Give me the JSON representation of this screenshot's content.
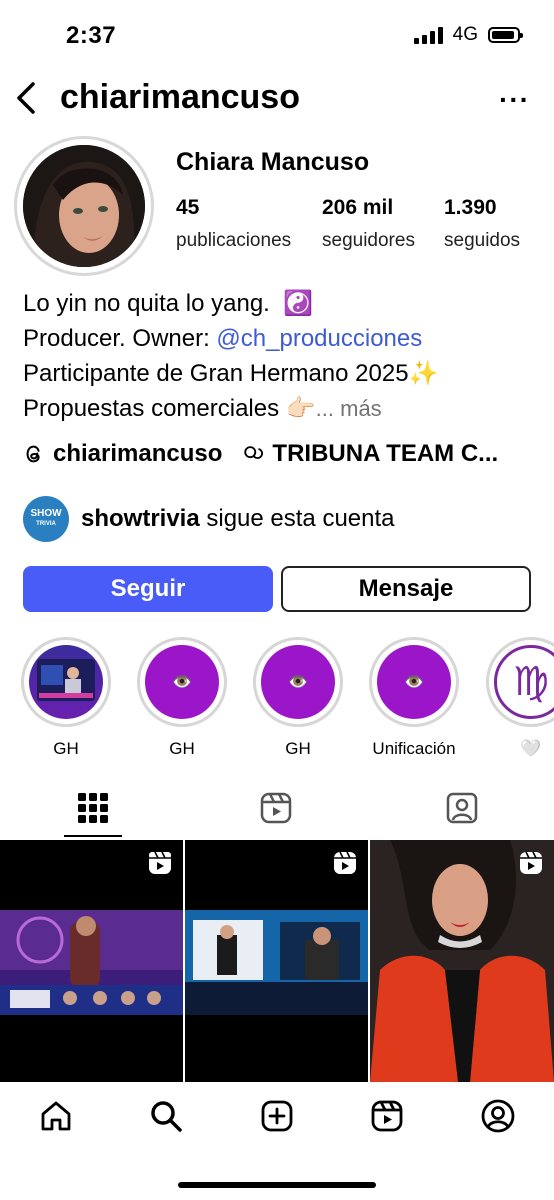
{
  "status_bar": {
    "time": "2:37",
    "network": "4G"
  },
  "header": {
    "username": "chiarimancuso",
    "more": "···"
  },
  "profile": {
    "display_name": "Chiara Mancuso",
    "stats": [
      {
        "value": "45",
        "label": "publicaciones"
      },
      {
        "value": "206 mil",
        "label": "seguidores"
      },
      {
        "value": "1.390",
        "label": "seguidos"
      }
    ],
    "bio": {
      "line1": "Lo yin no quita lo yang.",
      "line1_emoji": "☯️",
      "line2_prefix": "Producer. Owner: ",
      "line2_link": "@ch_producciones",
      "line3": "Participante de Gran Hermano 2025✨",
      "line4": "Propuestas comerciales 👉🏻",
      "line4_more": "... más"
    },
    "threads_handle": "chiarimancuso",
    "community": "TRIBUNA TEAM C..."
  },
  "followed_by": {
    "logo_text_top": "SHOW",
    "logo_text_bottom": "TRIVIA",
    "account": "showtrivia",
    "text": " sigue esta cuenta"
  },
  "actions": {
    "follow": "Seguir",
    "message": "Mensaje"
  },
  "highlights": [
    {
      "label": "GH"
    },
    {
      "label": "GH"
    },
    {
      "label": "GH"
    },
    {
      "label": "Unificación"
    },
    {
      "label": "🤍"
    }
  ],
  "colors": {
    "accent": "#4a5cf7",
    "link": "#3d5bd6",
    "highlight_purple": "#9b16c9"
  }
}
